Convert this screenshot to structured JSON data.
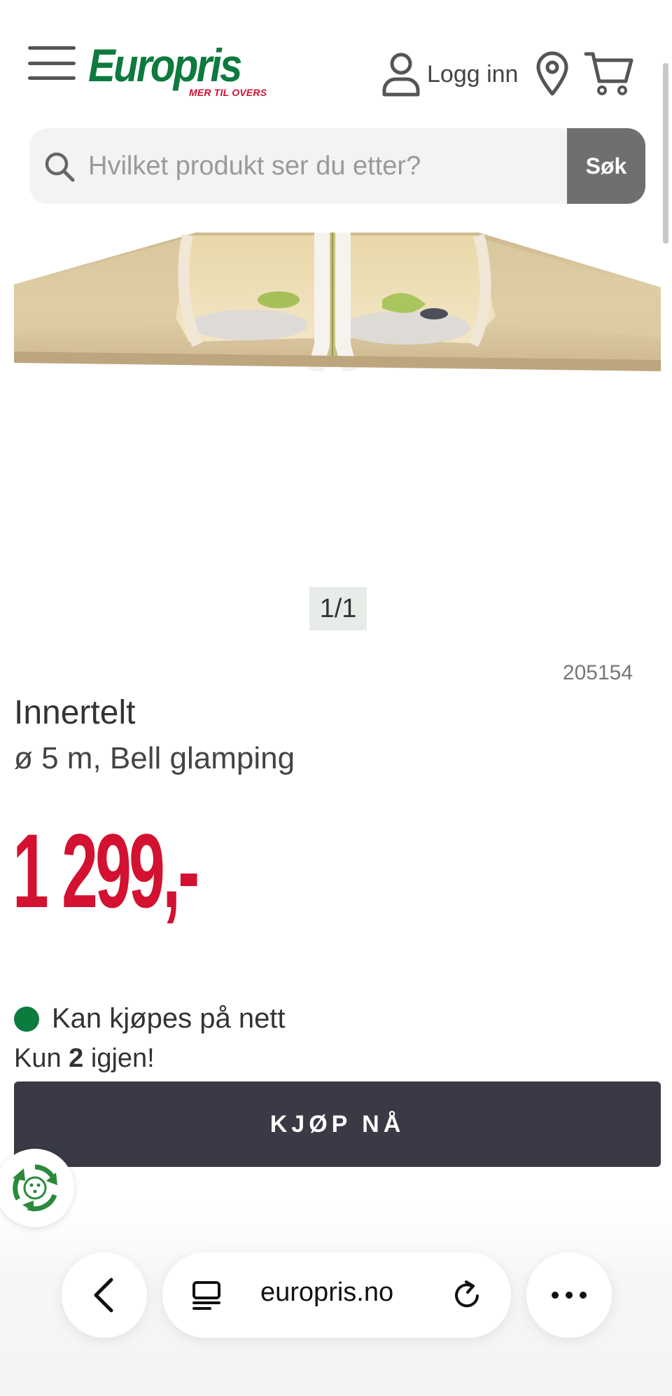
{
  "header": {
    "logo_text": "Europris",
    "logo_tagline": "MER TIL OVERS",
    "login_label": "Logg inn",
    "icons": [
      "menu-icon",
      "user-icon",
      "location-pin-icon",
      "cart-icon"
    ]
  },
  "search": {
    "placeholder": "Hvilket produkt ser du etter?",
    "button_label": "Søk"
  },
  "gallery": {
    "counter": "1/1"
  },
  "product": {
    "sku": "205154",
    "title": "Innertelt",
    "subtitle": "ø 5 m, Bell glamping",
    "price": "1 299,-"
  },
  "stock": {
    "availability": "Kan kjøpes på nett",
    "remaining_prefix": "Kun ",
    "remaining_count": "2",
    "remaining_suffix": " igjen!"
  },
  "buy_button_label": "KJØP NÅ",
  "browser": {
    "url": "europris.no",
    "icons": [
      "back-icon",
      "tabs-icon",
      "reload-icon",
      "more-icon"
    ]
  },
  "colors": {
    "brand_green": "#0d7a3e",
    "price_red": "#d31130",
    "button_dark": "#393a46",
    "search_button": "#6f6f6f"
  }
}
